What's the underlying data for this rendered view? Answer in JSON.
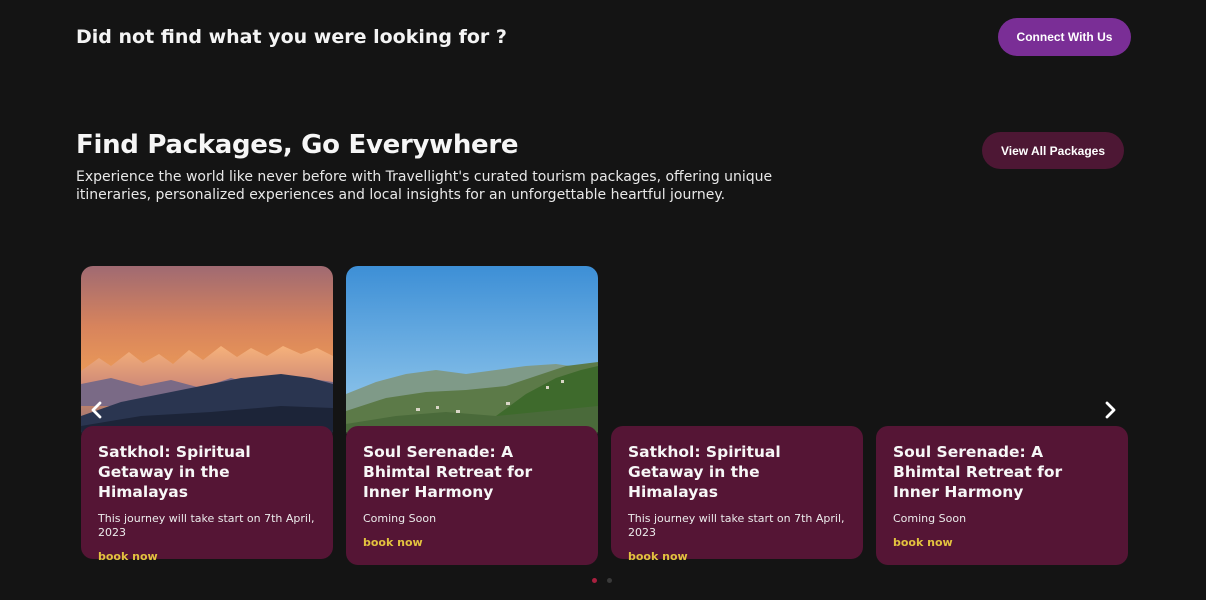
{
  "top_banner": {
    "title": "Did not find what you were looking for ?",
    "connect_label": "Connect With Us"
  },
  "packages": {
    "title": "Find Packages, Go Everywhere",
    "description": "Experience the world like never before with Travellight's curated tourism packages, offering unique itineraries, personalized experiences and local insights for an unforgettable heartful journey.",
    "view_all_label": "View All Packages",
    "cards": [
      {
        "title": "Satkhol: Spiritual Getaway in the Himalayas",
        "info": "This journey will take start on 7th April, 2023",
        "link": "book now"
      },
      {
        "title": "Soul Serenade: A Bhimtal Retreat for Inner Harmony",
        "info": "Coming Soon",
        "link": "book now"
      },
      {
        "title": "Satkhol: Spiritual Getaway in the Himalayas",
        "info": "This journey will take start on 7th April, 2023",
        "link": "book now"
      },
      {
        "title": "Soul Serenade: A Bhimtal Retreat for Inner Harmony",
        "info": "Coming Soon",
        "link": "book now"
      }
    ]
  },
  "carousel": {
    "prev_icon": "chevron-left-icon",
    "next_icon": "chevron-right-icon",
    "page_count": 2,
    "active_page": 1
  },
  "colors": {
    "background": "#141414",
    "connect_button": "#7a2e96",
    "view_all_button": "#4d1734",
    "card": "#551535",
    "link": "#e2c23f",
    "active_dot": "#a8203f"
  }
}
